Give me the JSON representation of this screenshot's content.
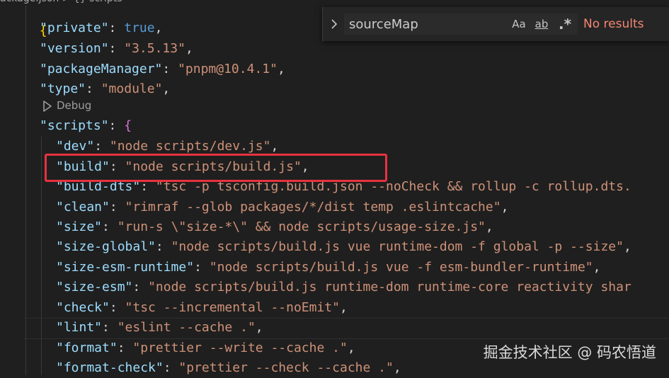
{
  "breadcrumb": {
    "text": "ackage.json > {} scripts"
  },
  "codelens": {
    "debug_label": "Debug"
  },
  "find": {
    "query": "sourceMap",
    "match_case_label": "Aa",
    "whole_word_label": "ab",
    "regex_label": ".*",
    "status": "No results"
  },
  "code": {
    "top_brace": "{",
    "private": {
      "key": "\"private\"",
      "value": "true"
    },
    "version": {
      "key": "\"version\"",
      "value": "\"3.5.13\""
    },
    "packageManager": {
      "key": "\"packageManager\"",
      "value": "\"pnpm@10.4.1\""
    },
    "type": {
      "key": "\"type\"",
      "value": "\"module\""
    },
    "scripts_key": "\"scripts\"",
    "scripts": [
      {
        "key": "\"dev\"",
        "value": "\"node scripts/dev.js\""
      },
      {
        "key": "\"build\"",
        "value": "\"node scripts/build.js\""
      },
      {
        "key": "\"build-dts\"",
        "value": "\"tsc -p tsconfig.build.json --noCheck && rollup -c rollup.dts."
      },
      {
        "key": "\"clean\"",
        "value": "\"rimraf --glob packages/*/dist temp .eslintcache\""
      },
      {
        "key": "\"size\"",
        "value": "\"run-s \\\"size-*\\\" && node scripts/usage-size.js\""
      },
      {
        "key": "\"size-global\"",
        "value": "\"node scripts/build.js vue runtime-dom -f global -p --size\""
      },
      {
        "key": "\"size-esm-runtime\"",
        "value": "\"node scripts/build.js vue -f esm-bundler-runtime\""
      },
      {
        "key": "\"size-esm\"",
        "value": "\"node scripts/build.js runtime-dom runtime-core reactivity shar"
      },
      {
        "key": "\"check\"",
        "value": "\"tsc --incremental --noEmit\""
      },
      {
        "key": "\"lint\"",
        "value": "\"eslint --cache .\""
      },
      {
        "key": "\"format\"",
        "value": "\"prettier --write --cache .\""
      },
      {
        "key": "\"format-check\"",
        "value": "\"prettier --check --cache .\""
      }
    ]
  },
  "watermark": {
    "text": "掘金技术社区 @ 码农悟道"
  },
  "colors": {
    "background": "#1f1f1f",
    "json_key": "#9cdcfe",
    "json_string": "#ce9178",
    "json_keyword": "#569cd6",
    "highlight_box": "#e8323f",
    "no_results": "#f48771"
  }
}
